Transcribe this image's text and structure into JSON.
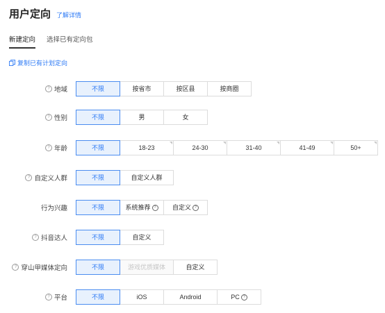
{
  "header": {
    "title": "用户定向",
    "detail_link": "了解详情"
  },
  "tabs": [
    {
      "label": "新建定向",
      "active": true
    },
    {
      "label": "选择已有定向包",
      "active": false
    }
  ],
  "copy_link": "复制已有计划定向",
  "accent_color": "#2f7bf5",
  "rows": [
    {
      "name": "region",
      "label": "地域",
      "help": true,
      "options": [
        {
          "label": "不限",
          "selected": true
        },
        {
          "label": "按省市"
        },
        {
          "label": "按区县"
        },
        {
          "label": "按商圈"
        }
      ]
    },
    {
      "name": "gender",
      "label": "性别",
      "help": true,
      "options": [
        {
          "label": "不限",
          "selected": true
        },
        {
          "label": "男"
        },
        {
          "label": "女"
        }
      ]
    },
    {
      "name": "age",
      "label": "年龄",
      "help": true,
      "options": [
        {
          "label": "不限",
          "selected": true
        },
        {
          "label": "18-23",
          "corner": true
        },
        {
          "label": "24-30",
          "corner": true
        },
        {
          "label": "31-40",
          "corner": true
        },
        {
          "label": "41-49",
          "corner": true
        },
        {
          "label": "50+",
          "corner": true
        }
      ]
    },
    {
      "name": "custom-audience",
      "label": "自定义人群",
      "help": true,
      "options": [
        {
          "label": "不限",
          "selected": true
        },
        {
          "label": "自定义人群"
        }
      ]
    },
    {
      "name": "behavior-interest",
      "label": "行为兴趣",
      "help": false,
      "options": [
        {
          "label": "不限",
          "selected": true
        },
        {
          "label": "系统推荐",
          "help": true
        },
        {
          "label": "自定义",
          "help": true
        }
      ]
    },
    {
      "name": "douyin-creator",
      "label": "抖音达人",
      "help": true,
      "options": [
        {
          "label": "不限",
          "selected": true
        },
        {
          "label": "自定义"
        }
      ]
    },
    {
      "name": "pangle-media",
      "label": "穿山甲媒体定向",
      "help": true,
      "options": [
        {
          "label": "不限",
          "selected": true
        },
        {
          "label": "游戏优质媒体",
          "disabled": true
        },
        {
          "label": "自定义"
        }
      ]
    },
    {
      "name": "platform",
      "label": "平台",
      "help": true,
      "options": [
        {
          "label": "不限",
          "selected": true
        },
        {
          "label": "iOS"
        },
        {
          "label": "Android"
        },
        {
          "label": "PC",
          "help": true
        }
      ]
    }
  ]
}
